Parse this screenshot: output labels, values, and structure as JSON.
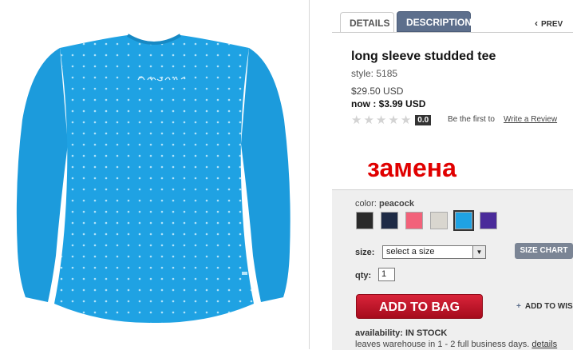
{
  "tabs": {
    "details": "DETAILS",
    "description": "DESCRIPTION",
    "prev": "PREV"
  },
  "product": {
    "title": "long sleeve studded tee",
    "style": "style: 5185",
    "original_price": "$29.50 USD",
    "now_price": "now : $3.99 USD",
    "rating": "0.0",
    "stars_filled": 0,
    "stars_total": 5,
    "be_first": "Be the first to",
    "write_review": "Write a Review",
    "logo_text": "Aeropostale"
  },
  "overlay_text": "замена",
  "options": {
    "color_label": "color:",
    "color_value": "peacock",
    "swatches": [
      {
        "name": "black",
        "color": "#2a2a2a"
      },
      {
        "name": "navy",
        "color": "#1d2a45"
      },
      {
        "name": "pink",
        "color": "#f2627a"
      },
      {
        "name": "light-gray",
        "color": "#d9d6cf"
      },
      {
        "name": "peacock",
        "color": "#1fa2e3",
        "selected": true
      },
      {
        "name": "purple",
        "color": "#4a2b9a"
      }
    ],
    "size_label": "size:",
    "size_value": "select a size",
    "size_chart": "SIZE CHART",
    "qty_label": "qty:",
    "qty_value": "1"
  },
  "actions": {
    "add_to_bag": "ADD TO BAG",
    "add_to_wishlist": "ADD TO WIS"
  },
  "availability": {
    "text": "availability: IN STOCK",
    "leaves": "leaves warehouse in 1 - 2 full business days.",
    "details": "details"
  },
  "colors": {
    "shirt": "#1fa2e3",
    "accent_red": "#e00000",
    "tab_blue": "#5d6f8c"
  }
}
